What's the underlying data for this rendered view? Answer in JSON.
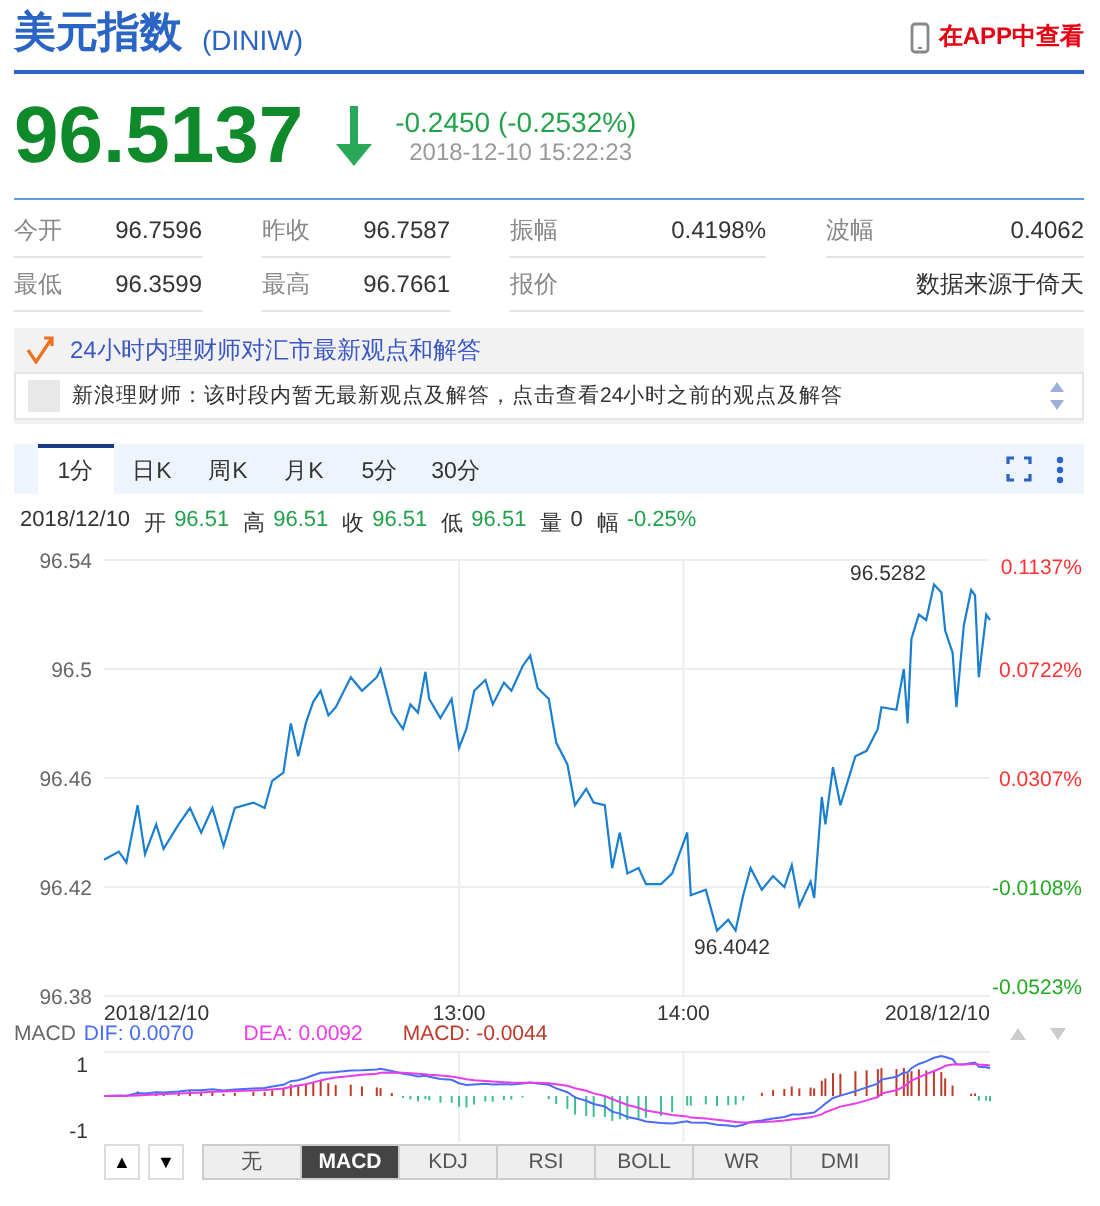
{
  "header": {
    "title": "美元指数",
    "code": "(DINIW)",
    "app_link": "在APP中查看"
  },
  "quote": {
    "price": "96.5137",
    "kind": "down",
    "change": "-0.2450 (-0.2532%)",
    "time": "2018-12-10 15:22:23"
  },
  "stats": [
    {
      "label": "今开",
      "value": "96.7596"
    },
    {
      "label": "昨收",
      "value": "96.7587"
    },
    {
      "label": "振幅",
      "value": "0.4198%"
    },
    {
      "label": "波幅",
      "value": "0.4062"
    },
    {
      "label": "最低",
      "value": "96.3599"
    },
    {
      "label": "最高",
      "value": "96.7661"
    },
    {
      "label": "报价",
      "value": "数据来源于倚天"
    }
  ],
  "advisor": {
    "heading": "24小时内理财师对汇市最新观点和解答",
    "message": "新浪理财师：该时段内暂无最新观点及解答，点击查看24小时之前的观点及解答"
  },
  "period_tabs": [
    {
      "label": "1分",
      "selected": true
    },
    {
      "label": "日K",
      "selected": false
    },
    {
      "label": "周K",
      "selected": false
    },
    {
      "label": "月K",
      "selected": false
    },
    {
      "label": "5分",
      "selected": false
    },
    {
      "label": "30分",
      "selected": false
    }
  ],
  "bar_info": {
    "date": "2018/12/10",
    "fields": [
      {
        "label": "开",
        "value": "96.51",
        "color": "#22a24a"
      },
      {
        "label": "高",
        "value": "96.51",
        "color": "#22a24a"
      },
      {
        "label": "收",
        "value": "96.51",
        "color": "#22a24a"
      },
      {
        "label": "低",
        "value": "96.51",
        "color": "#22a24a"
      },
      {
        "label": "量",
        "value": "0",
        "color": "#333333"
      },
      {
        "label": "幅",
        "value": "-0.25%",
        "color": "#22a24a"
      }
    ]
  },
  "price_chart": {
    "chart_data": {
      "type": "line",
      "grid": true,
      "xlim": [
        11.417,
        15.367
      ],
      "ylim": [
        96.38,
        96.54
      ],
      "yticks": [
        96.38,
        96.42,
        96.46,
        96.5,
        96.54
      ],
      "xticks": [
        {
          "value": 11.417,
          "label": "2018/12/10"
        },
        {
          "value": 13,
          "label": "13:00"
        },
        {
          "value": 14,
          "label": "14:00"
        },
        {
          "value": 15.367,
          "label": "2018/12/10"
        }
      ],
      "x": [
        11.417,
        11.483,
        11.517,
        11.567,
        11.6,
        11.65,
        11.683,
        11.75,
        11.8,
        11.85,
        11.9,
        11.95,
        12.0,
        12.083,
        12.133,
        12.167,
        12.217,
        12.25,
        12.283,
        12.317,
        12.35,
        12.383,
        12.417,
        12.45,
        12.517,
        12.567,
        12.633,
        12.65,
        12.7,
        12.75,
        12.783,
        12.817,
        12.85,
        12.867,
        12.917,
        12.967,
        13.0,
        13.033,
        13.067,
        13.117,
        13.15,
        13.2,
        13.233,
        13.283,
        13.317,
        13.35,
        13.4,
        13.433,
        13.483,
        13.517,
        13.567,
        13.6,
        13.65,
        13.683,
        13.717,
        13.75,
        13.8,
        13.833,
        13.9,
        13.95,
        14.017,
        14.033,
        14.1,
        14.15,
        14.2,
        14.233,
        14.267,
        14.3,
        14.35,
        14.4,
        14.45,
        14.483,
        14.517,
        14.567,
        14.583,
        14.617,
        14.633,
        14.667,
        14.7,
        14.767,
        14.817,
        14.867,
        14.883,
        14.95,
        14.983,
        15.0,
        15.017,
        15.05,
        15.083,
        15.117,
        15.15,
        15.167,
        15.2,
        15.217,
        15.25,
        15.283,
        15.3,
        15.317,
        15.35,
        15.367
      ],
      "series": [
        {
          "color": "#1a7fd0",
          "values": [
            96.43,
            96.433,
            96.429,
            96.45,
            96.432,
            96.443,
            96.434,
            96.443,
            96.449,
            96.44,
            96.449,
            96.435,
            96.449,
            96.451,
            96.449,
            96.459,
            96.462,
            96.48,
            96.468,
            96.48,
            96.488,
            96.492,
            96.483,
            96.486,
            96.497,
            96.492,
            96.497,
            96.5,
            96.484,
            96.478,
            96.487,
            96.484,
            96.499,
            96.489,
            96.482,
            96.489,
            96.471,
            96.478,
            96.492,
            96.496,
            96.487,
            96.495,
            96.492,
            96.501,
            96.505,
            96.493,
            96.489,
            96.473,
            96.465,
            96.45,
            96.456,
            96.451,
            96.45,
            96.427,
            96.44,
            96.425,
            96.427,
            96.421,
            96.421,
            96.425,
            96.44,
            96.417,
            96.419,
            96.404,
            96.408,
            96.404,
            96.417,
            96.427,
            96.419,
            96.424,
            96.42,
            96.428,
            96.413,
            96.422,
            96.416,
            96.453,
            96.443,
            96.464,
            96.45,
            96.468,
            96.47,
            96.478,
            96.486,
            96.485,
            96.5,
            96.48,
            96.511,
            96.52,
            96.518,
            96.531,
            96.528,
            96.514,
            96.506,
            96.486,
            96.516,
            96.529,
            96.527,
            96.497,
            96.52,
            96.518
          ]
        }
      ],
      "annotations": [
        {
          "x": 15.117,
          "y": 96.5282,
          "text": "96.5282"
        },
        {
          "x": 14.217,
          "y": 96.4042,
          "text": "96.4042"
        }
      ]
    },
    "right_axis": [
      {
        "text": "0.1137%",
        "color": "#ff3333"
      },
      {
        "text": "0.0722%",
        "color": "#ff3333"
      },
      {
        "text": "0.0307%",
        "color": "#ff3333"
      },
      {
        "text": "-0.0108%",
        "color": "#22aa22"
      },
      {
        "text": "-0.0523%",
        "color": "#22aa22"
      }
    ]
  },
  "macd": {
    "title": "MACD",
    "legend": [
      {
        "text": "DIF: 0.0070",
        "color": "#4a6cf7"
      },
      {
        "text": "DEA: 0.0092",
        "color": "#e83de8"
      },
      {
        "text": "MACD: -0.0044",
        "color": "#c0392b"
      }
    ],
    "top_label": "1",
    "bottom_label": "-1"
  },
  "scroll_buttons": [
    "▲",
    "▼"
  ],
  "indicator_tabs": [
    {
      "label": "无",
      "selected": false
    },
    {
      "label": "MACD",
      "selected": true
    },
    {
      "label": "KDJ",
      "selected": false
    },
    {
      "label": "RSI",
      "selected": false
    },
    {
      "label": "BOLL",
      "selected": false
    },
    {
      "label": "WR",
      "selected": false
    },
    {
      "label": "DMI",
      "selected": false
    }
  ]
}
